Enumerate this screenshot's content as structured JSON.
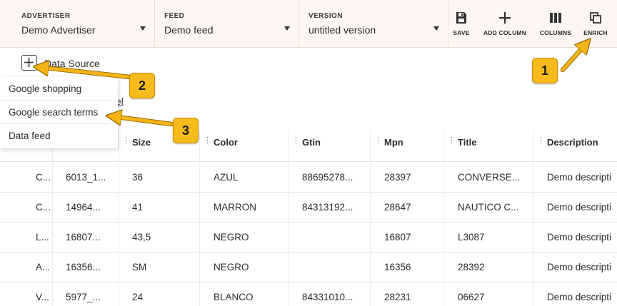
{
  "topbar": {
    "advertiser": {
      "label": "ADVERTISER",
      "value": "Demo Advertiser"
    },
    "feed": {
      "label": "FEED",
      "value": "Demo feed"
    },
    "version": {
      "label": "VERSION",
      "value": "untitled version"
    },
    "tools": [
      {
        "label": "SAVE",
        "icon": "save-icon"
      },
      {
        "label": "ADD COLUMN",
        "icon": "plus-icon"
      },
      {
        "label": "COLUMNS",
        "icon": "columns-icon"
      },
      {
        "label": "ENRICH",
        "icon": "enrich-icon"
      }
    ]
  },
  "data_source": {
    "label": "Data Source",
    "partial_link": "el"
  },
  "menu": {
    "items": [
      "Google shopping",
      "Google search terms",
      "Data feed"
    ]
  },
  "table": {
    "columns": [
      "Size",
      "Color",
      "Gtin",
      "Mpn",
      "Title",
      "Description"
    ],
    "rows": [
      [
        "C...",
        "6013_1...",
        "36",
        "AZUL",
        "88695278...",
        "28397",
        "CONVERSE...",
        "Demo descripti"
      ],
      [
        "C...",
        "14964...",
        "41",
        "MARRON",
        "84313192...",
        "28647",
        "NAUTICO C...",
        "Demo descripti"
      ],
      [
        "L...",
        "16807...",
        "43,5",
        "NEGRO",
        "",
        "16807",
        "L3087",
        "Demo descripti"
      ],
      [
        "A...",
        "16356...",
        "SM",
        "NEGRO",
        "",
        "16356",
        "28392",
        "Demo descripti"
      ],
      [
        "V...",
        "5977_...",
        "24",
        "BLANCO",
        "84331010...",
        "28231",
        "06627",
        "Demo descripti"
      ]
    ]
  },
  "callouts": [
    "1",
    "2",
    "3"
  ],
  "colors": {
    "topbar_bg": "#fdf6f2",
    "badge": "#f7bc1b",
    "arrow": "#f5b417"
  }
}
